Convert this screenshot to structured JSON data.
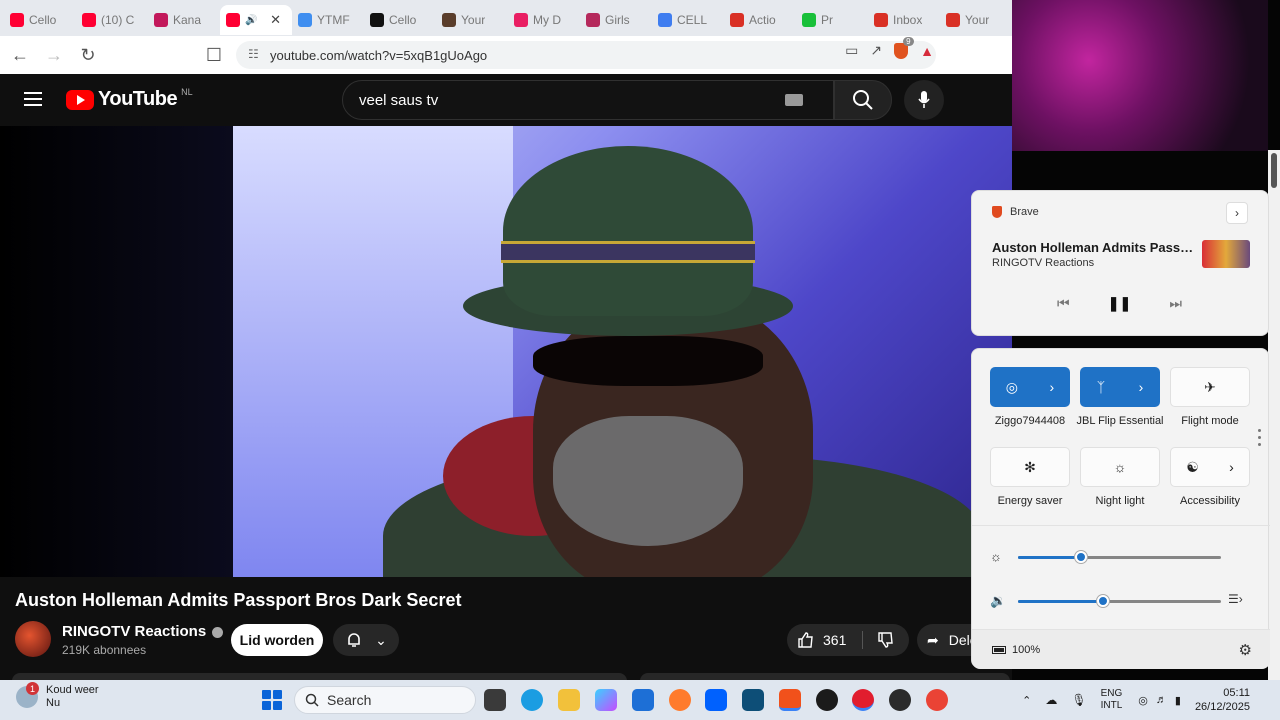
{
  "browser": {
    "tabs": [
      {
        "title": "Cello",
        "favicon_color": "#ff0033",
        "active": false
      },
      {
        "title": "(10) C",
        "favicon_color": "#ff0033",
        "active": false
      },
      {
        "title": "Kana",
        "favicon_color": "#c2185b",
        "active": false
      },
      {
        "title": "",
        "favicon_color": "#ff0033",
        "active": true,
        "audio": true
      },
      {
        "title": "YTMF",
        "favicon_color": "#3f8ef0",
        "active": false
      },
      {
        "title": "Cello",
        "favicon_color": "#111111",
        "active": false
      },
      {
        "title": "Your",
        "favicon_color": "#5a3d2b",
        "active": false
      },
      {
        "title": "My D",
        "favicon_color": "#e91e63",
        "active": false
      },
      {
        "title": "Girls",
        "favicon_color": "#b5295c",
        "active": false
      },
      {
        "title": "CELL",
        "favicon_color": "#3f7df0",
        "active": false
      },
      {
        "title": "Actio",
        "favicon_color": "#d93025",
        "active": false
      },
      {
        "title": "Pr",
        "favicon_color": "#19c03a",
        "active": false
      },
      {
        "title": "Inbox",
        "favicon_color": "#d93025",
        "active": false
      },
      {
        "title": "Your",
        "favicon_color": "#d93025",
        "active": false
      }
    ],
    "url": "youtube.com/watch?v=5xqB1gUoAgo",
    "brave_badge": "9"
  },
  "youtube": {
    "logo_text": "YouTube",
    "country": "NL",
    "search_value": "veel saus tv",
    "video_title": "Auston Holleman Admits Passport Bros Dark Secret",
    "channel_name": "RINGOTV Reactions",
    "subscribers": "219K abonnees",
    "join_label": "Lid worden",
    "likes": "361",
    "share_label": "Delen"
  },
  "media_flyout": {
    "app": "Brave",
    "title": "Auston Holleman Admits Passpor...",
    "artist": "RINGOTV Reactions"
  },
  "quick_settings": {
    "tiles": [
      {
        "label": "Ziggo7944408",
        "icon": "wifi-icon",
        "on": true
      },
      {
        "label": "JBL Flip Essential",
        "icon": "bluetooth-icon",
        "on": true
      },
      {
        "label": "Flight mode",
        "icon": "airplane-icon",
        "on": false
      },
      {
        "label": "Energy saver",
        "icon": "leaf-icon",
        "on": false
      },
      {
        "label": "Night light",
        "icon": "sun-icon",
        "on": false
      },
      {
        "label": "Accessibility",
        "icon": "accessibility-icon",
        "on": false
      }
    ],
    "brightness_level": 0.31,
    "volume_level": 0.42,
    "battery": "100%"
  },
  "taskbar": {
    "weather_badge": "1",
    "weather_line1": "Koud weer",
    "weather_line2": "Nu",
    "search_label": "Search",
    "lang_line1": "ENG",
    "lang_line2": "INTL",
    "time": "05:11",
    "date": "26/12/2025"
  },
  "colors": {
    "youtube_red": "#ff0000",
    "windows_accent": "#1f72c6"
  }
}
